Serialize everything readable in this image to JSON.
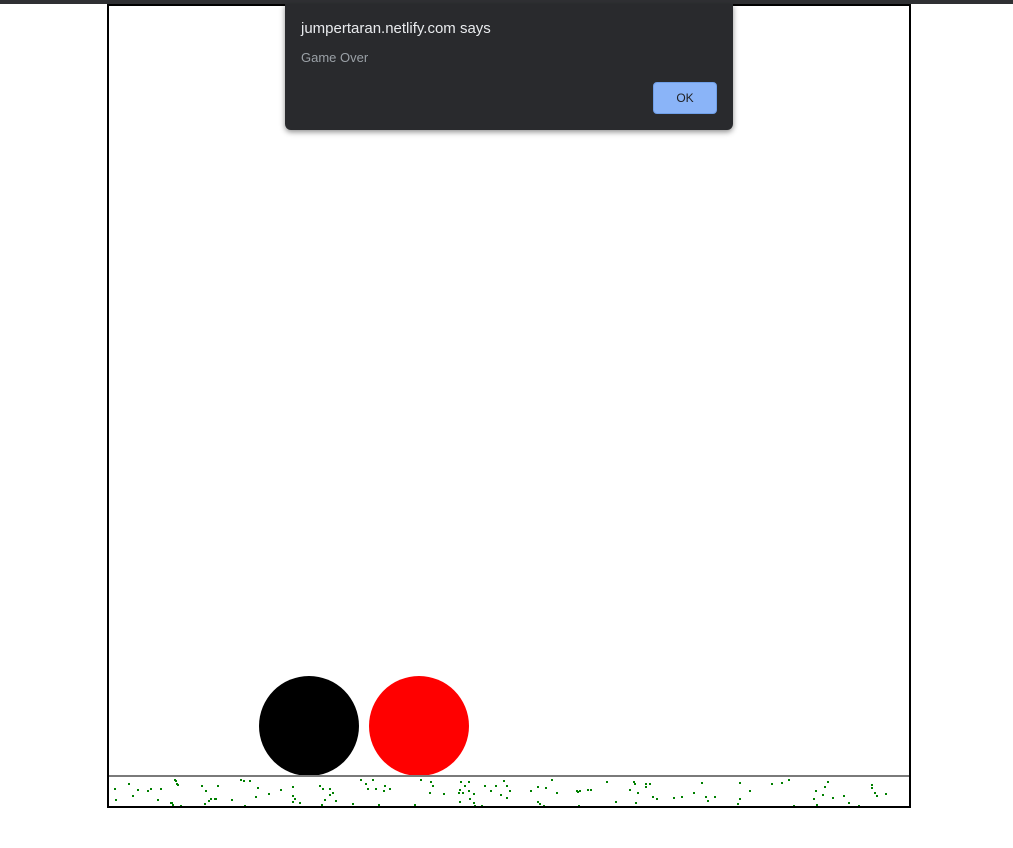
{
  "alert": {
    "title": "jumpertaran.netlify.com says",
    "message": "Game Over",
    "ok_label": "OK"
  },
  "game": {
    "player_color": "#000000",
    "enemy_color": "#ff0000",
    "grass_color": "#008000",
    "ground_line_color": "#7a7a7a",
    "canvas_border_color": "#000000"
  }
}
